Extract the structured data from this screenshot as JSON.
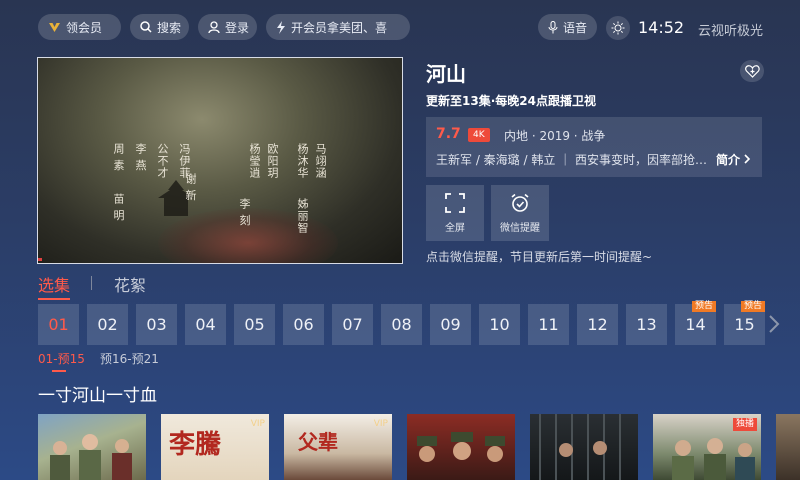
{
  "topbar": {
    "vip": "领会员",
    "search": "搜索",
    "login": "登录",
    "promo": "开会员拿美团、喜",
    "voice": "语音",
    "time": "14:52",
    "brand": "云视听极光"
  },
  "player": {
    "credits": [
      "马翊涵",
      "杨沐华",
      "姊丽智",
      "欧阳玥",
      "杨瑩逍",
      "李 刻",
      "谢 新",
      "冯伊菲",
      "公不才",
      "李 燕",
      "周 素",
      "苗 明"
    ]
  },
  "detail": {
    "title": "河山",
    "update": "更新至13集·每晚24点跟播卫视",
    "score": "7.7",
    "badge": "4K",
    "meta": "内地 · 2019 · 战争",
    "cast": "王新军 / 秦海璐 / 韩立 ｜ 西安事变时，因率部抢占…",
    "intro": "简介",
    "fullscreen": "全屏",
    "wechat": "微信提醒",
    "tip": "点击微信提醒，节目更新后第一时间提醒~"
  },
  "tabs": [
    "选集",
    "花絮"
  ],
  "episodes": [
    "01",
    "02",
    "03",
    "04",
    "05",
    "06",
    "07",
    "08",
    "09",
    "10",
    "11",
    "12",
    "13",
    "14",
    "15"
  ],
  "preview_label": "预告",
  "ranges": [
    "01-预15",
    "预16-预21"
  ],
  "recommend": {
    "title": "一寸河山一寸血",
    "posters": [
      {
        "tag": ""
      },
      {
        "tag": "VIP",
        "art": "李騰"
      },
      {
        "tag": "VIP",
        "art": "父辈"
      },
      {
        "tag": ""
      },
      {
        "tag": ""
      },
      {
        "tag": "独播"
      }
    ]
  },
  "colors": {
    "accent": "#ff5a4a",
    "preview": "#f07a25"
  }
}
